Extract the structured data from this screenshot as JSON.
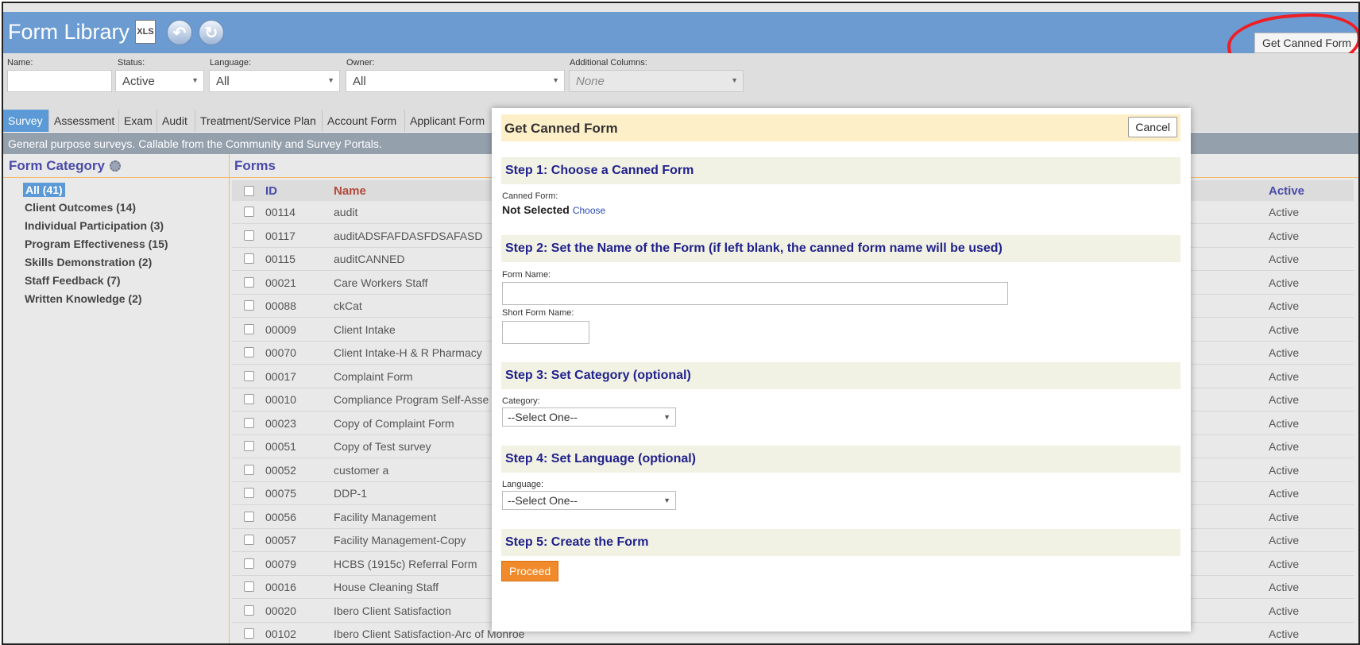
{
  "app": {
    "title": "Form Library",
    "xls_label": "XLS",
    "get_canned_label": "Get Canned Form"
  },
  "filters": {
    "name_label": "Name:",
    "name_value": "",
    "status_label": "Status:",
    "status_value": "Active",
    "language_label": "Language:",
    "language_value": "All",
    "owner_label": "Owner:",
    "owner_value": "All",
    "additional_label": "Additional Columns:",
    "additional_value": "None"
  },
  "tabs": [
    "Survey",
    "Assessment",
    "Exam",
    "Audit",
    "Treatment/Service Plan",
    "Account Form",
    "Applicant Form"
  ],
  "description": "General purpose surveys. Callable from the Community and Survey Portals.",
  "categories": {
    "title": "Form Category",
    "items": [
      "All (41)",
      "Client Outcomes (14)",
      "Individual Participation (3)",
      "Program Effectiveness (15)",
      "Skills Demonstration (2)",
      "Staff Feedback (7)",
      "Written Knowledge (2)"
    ]
  },
  "forms": {
    "title": "Forms",
    "columns": {
      "id": "ID",
      "name": "Name",
      "active": "Active"
    },
    "rows": [
      {
        "id": "00114",
        "name": "audit",
        "status": "Active"
      },
      {
        "id": "00117",
        "name": "auditADSFAFDASFDSAFASD",
        "status": "Active"
      },
      {
        "id": "00115",
        "name": "auditCANNED",
        "status": "Active"
      },
      {
        "id": "00021",
        "name": "Care Workers Staff",
        "status": "Active"
      },
      {
        "id": "00088",
        "name": "ckCat",
        "status": "Active"
      },
      {
        "id": "00009",
        "name": "Client Intake",
        "status": "Active"
      },
      {
        "id": "00070",
        "name": "Client Intake-H & R Pharmacy",
        "status": "Active"
      },
      {
        "id": "00017",
        "name": "Complaint Form",
        "status": "Active"
      },
      {
        "id": "00010",
        "name": "Compliance Program Self-Asse",
        "status": "Active"
      },
      {
        "id": "00023",
        "name": "Copy of Complaint Form",
        "status": "Active"
      },
      {
        "id": "00051",
        "name": "Copy of Test survey",
        "status": "Active"
      },
      {
        "id": "00052",
        "name": "customer a",
        "status": "Active"
      },
      {
        "id": "00075",
        "name": "DDP-1",
        "status": "Active"
      },
      {
        "id": "00056",
        "name": "Facility Management",
        "status": "Active"
      },
      {
        "id": "00057",
        "name": "Facility Management-Copy",
        "status": "Active"
      },
      {
        "id": "00079",
        "name": "HCBS (1915c) Referral Form",
        "status": "Active"
      },
      {
        "id": "00016",
        "name": "House Cleaning Staff",
        "status": "Active"
      },
      {
        "id": "00020",
        "name": "Ibero Client Satisfaction",
        "status": "Active"
      },
      {
        "id": "00102",
        "name": "Ibero Client Satisfaction-Arc of Monroe",
        "status": "Active"
      }
    ]
  },
  "modal": {
    "title": "Get Canned Form",
    "cancel_label": "Cancel",
    "step1": "Step 1: Choose a Canned Form",
    "canned_label": "Canned Form:",
    "canned_value": "Not Selected",
    "choose_link": "Choose",
    "step2": "Step 2: Set the Name of the Form (if left blank, the canned form name will be used)",
    "form_name_label": "Form Name:",
    "short_name_label": "Short Form Name:",
    "step3": "Step 3: Set Category (optional)",
    "category_label": "Category:",
    "category_value": "--Select One--",
    "step4": "Step 4: Set Language (optional)",
    "language_label": "Language:",
    "language_value": "--Select One--",
    "step5": "Step 5: Create the Form",
    "proceed_label": "Proceed"
  }
}
